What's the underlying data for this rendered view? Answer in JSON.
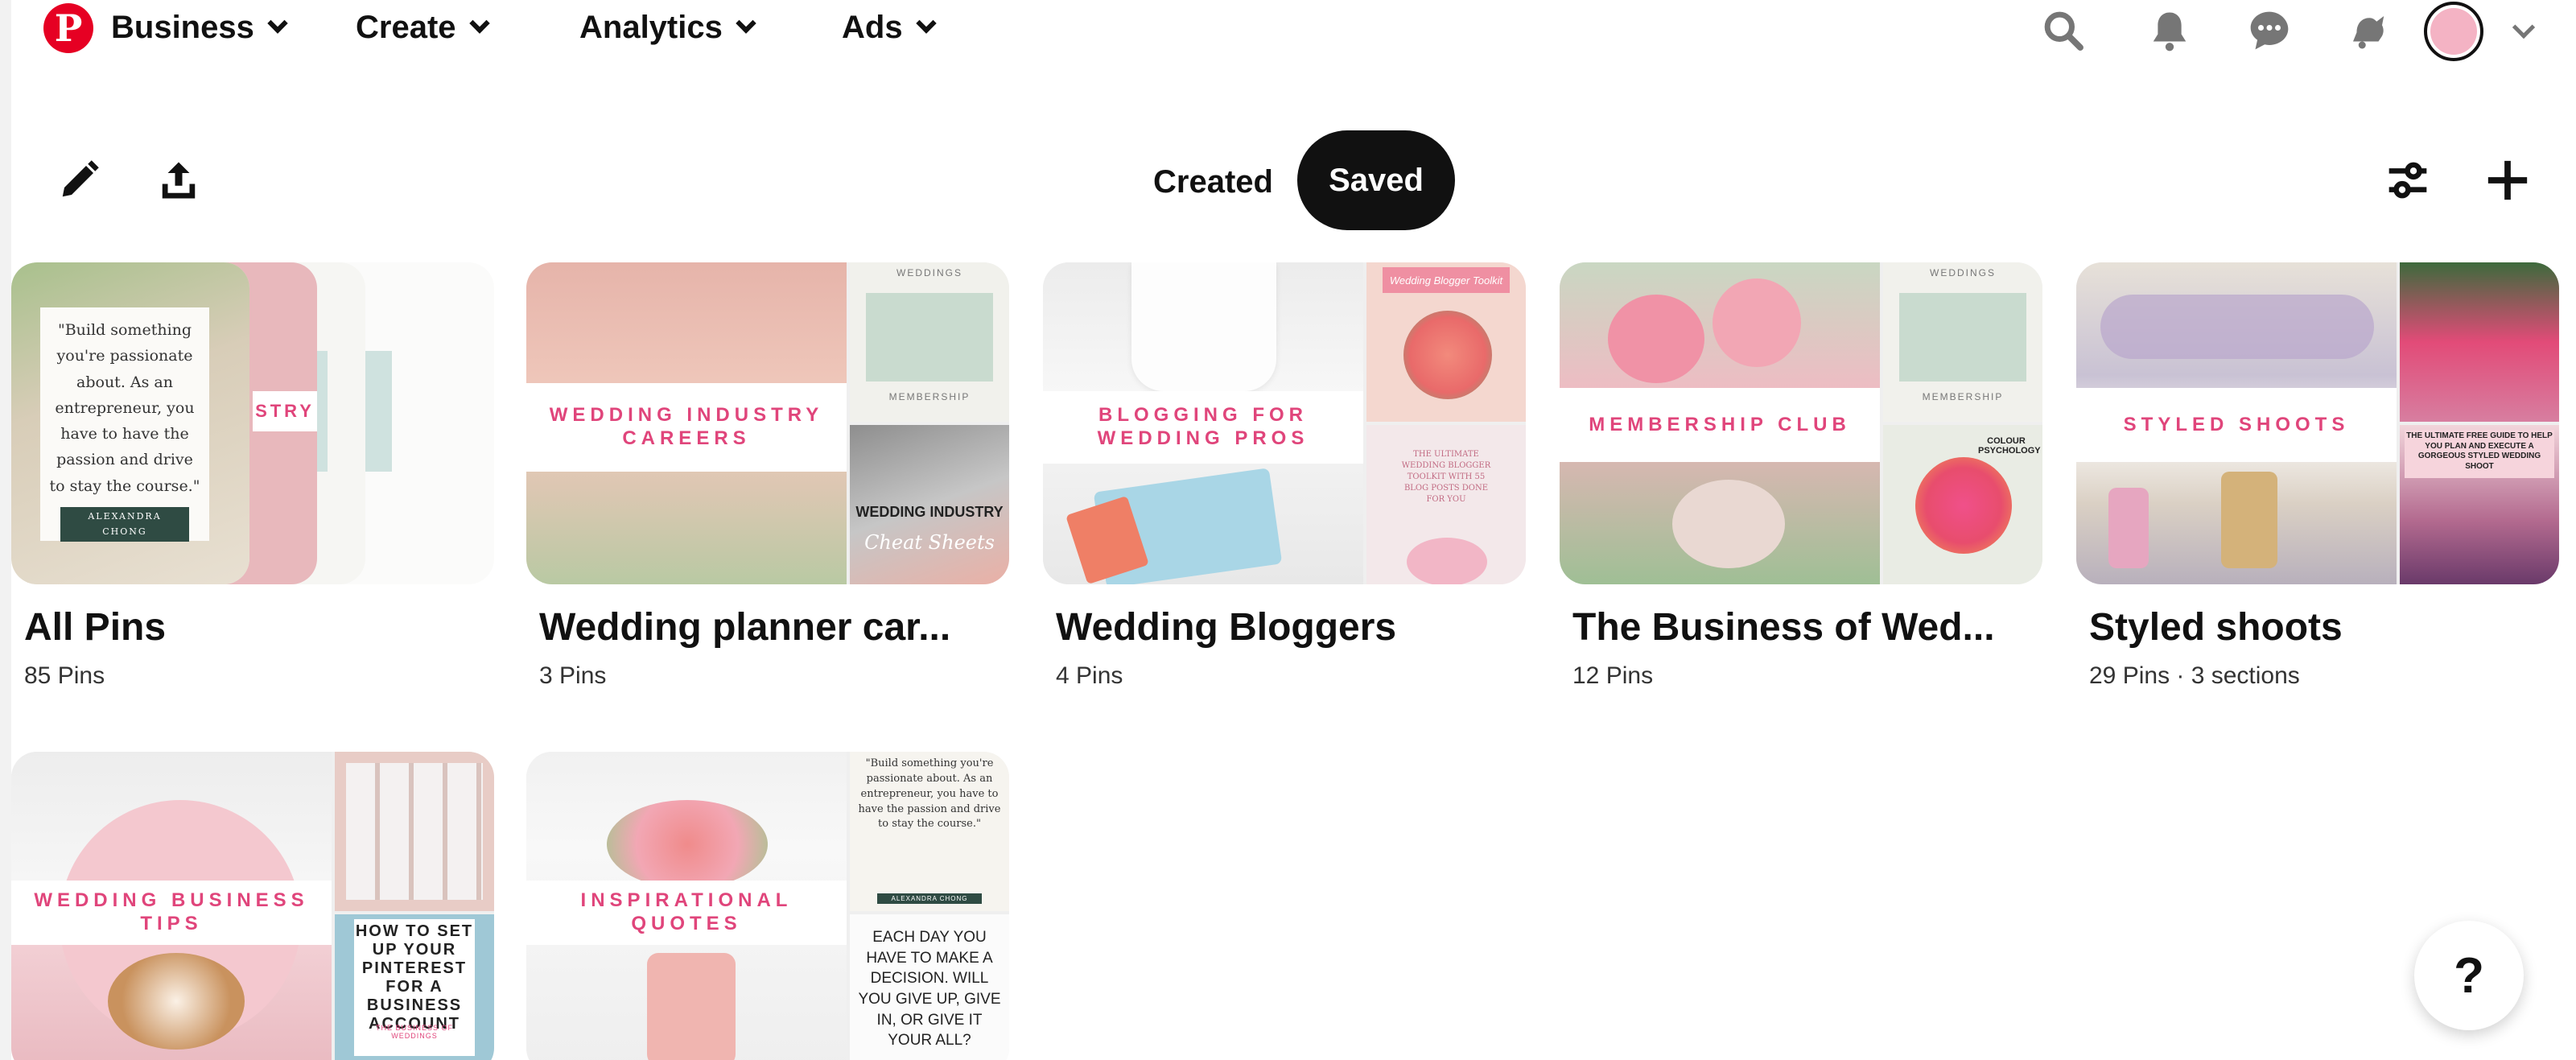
{
  "nav": {
    "logo_letter": "P",
    "items": [
      {
        "label": "Business"
      },
      {
        "label": "Create"
      },
      {
        "label": "Analytics"
      },
      {
        "label": "Ads"
      }
    ],
    "icons": [
      "search-icon",
      "notifications-icon",
      "messages-icon",
      "updates-icon"
    ]
  },
  "tabs": {
    "created": "Created",
    "saved": "Saved"
  },
  "boards": [
    {
      "title": "All Pins",
      "meta": "85 Pins",
      "quote": "\"Build something you're passionate about. As an entrepreneur, you have to have the passion and drive to stay the course.\"",
      "quote_author": "ALEXANDRA CHONG",
      "strip_text": "STRY"
    },
    {
      "title": "Wedding planner car...",
      "meta": "3 Pins",
      "band": "WEDDING INDUSTRY CAREERS",
      "small1_label": "WEDDINGS",
      "small1_sub": "MEMBERSHIP",
      "small2_label": "WEDDING INDUSTRY",
      "small2_sub": "Cheat Sheets"
    },
    {
      "title": "Wedding Bloggers",
      "meta": "4 Pins",
      "band": "BLOGGING FOR WEDDING PROS",
      "small1_label": "Wedding Blogger Toolkit",
      "small2_label": "THE ULTIMATE WEDDING BLOGGER TOOLKIT WITH 55 BLOG POSTS DONE FOR YOU"
    },
    {
      "title": "The Business of Wed...",
      "meta": "12 Pins",
      "band": "MEMBERSHIP CLUB",
      "small1_label": "WEDDINGS",
      "small1_sub": "MEMBERSHIP",
      "small2_label": "COLOUR PSYCHOLOGY"
    },
    {
      "title": "Styled shoots",
      "meta": "29 Pins · 3 sections",
      "band": "STYLED SHOOTS",
      "small2_label": "THE ULTIMATE FREE GUIDE TO HELP YOU PLAN AND EXECUTE A GORGEOUS STYLED WEDDING SHOOT"
    },
    {
      "band": "WEDDING BUSINESS TIPS",
      "small2_label": "HOW TO SET UP YOUR PINTEREST FOR A BUSINESS ACCOUNT",
      "small2_sub": "THE BUSINESS OF WEDDINGS"
    },
    {
      "band": "INSPIRATIONAL QUOTES",
      "small1_quote": "\"Build something you're passionate about. As an entrepreneur, you have to have the passion and drive to stay the course.\"",
      "small1_author": "ALEXANDRA CHONG",
      "small2_label": "EACH DAY YOU HAVE TO MAKE A DECISION. WILL YOU GIVE UP, GIVE IN, OR GIVE IT YOUR ALL?"
    }
  ],
  "help_label": "?"
}
